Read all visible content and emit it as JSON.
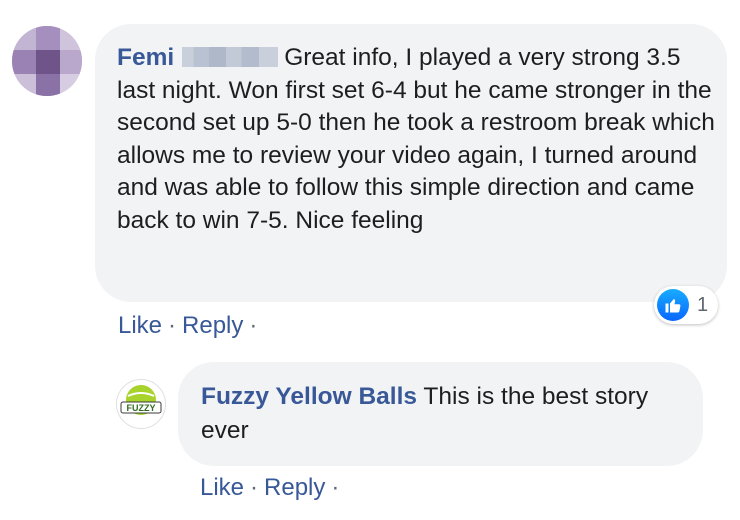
{
  "comment": {
    "author_first": "Femi",
    "text": "Great info, I played a very strong 3.5 last night. Won first set 6-4 but he came stronger in the second set up 5-0 then he took a restroom break which allows me to review your video again, I turned around and was able to follow this simple direction and came back to win 7-5. Nice feeling",
    "like_label": "Like",
    "reply_label": "Reply",
    "separator": "·",
    "reaction_count": "1"
  },
  "reply": {
    "author": "Fuzzy Yellow Balls",
    "text": "This is the best story ever",
    "like_label": "Like",
    "reply_label": "Reply",
    "separator": "·",
    "avatar_text": "FUZZY"
  },
  "colors": {
    "author_link": "#385898",
    "bubble_bg": "#f2f3f5",
    "like_blue": "#0866ff",
    "fuzzy_green": "#a8d22c"
  }
}
